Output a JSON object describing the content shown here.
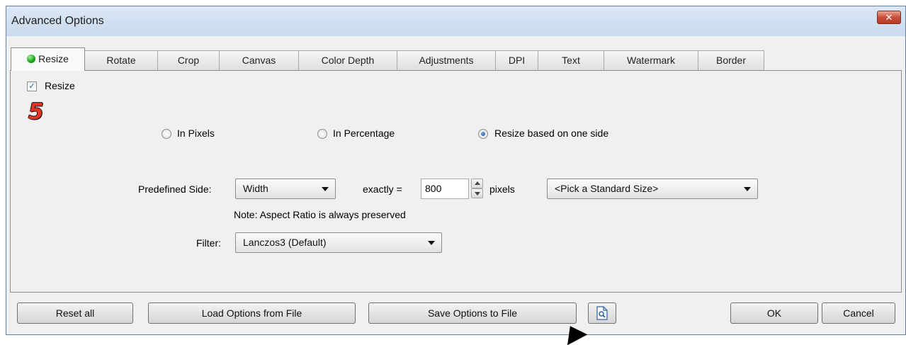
{
  "window": {
    "title": "Advanced Options",
    "close_glyph": "✕"
  },
  "tabs": [
    {
      "label": "Resize",
      "active": true,
      "icon": "green-dot-icon"
    },
    {
      "label": "Rotate"
    },
    {
      "label": "Crop"
    },
    {
      "label": "Canvas"
    },
    {
      "label": "Color Depth"
    },
    {
      "label": "Adjustments"
    },
    {
      "label": "DPI"
    },
    {
      "label": "Text"
    },
    {
      "label": "Watermark"
    },
    {
      "label": "Border"
    }
  ],
  "resize": {
    "enable_label": "Resize",
    "enable_checked": true,
    "annotation_number": "5",
    "modes": [
      {
        "label": "In Pixels",
        "selected": false
      },
      {
        "label": "In Percentage",
        "selected": false
      },
      {
        "label": "Resize based on one side",
        "selected": true
      }
    ],
    "predefined_side_label": "Predefined Side:",
    "predefined_side_value": "Width",
    "exactly_label": "exactly =",
    "exactly_value": "800",
    "unit_label": "pixels",
    "standard_size_value": "<Pick a Standard Size>",
    "note": "Note: Aspect Ratio is always preserved",
    "filter_label": "Filter:",
    "filter_value": "Lanczos3 (Default)"
  },
  "footer": {
    "reset_all": "Reset all",
    "load_options": "Load Options from File",
    "save_options": "Save Options to File",
    "ok": "OK",
    "cancel": "Cancel"
  },
  "colors": {
    "titlebar": "#c9daee",
    "client_bg": "#f0f0f0",
    "close_red": "#c9503b",
    "annotation_red": "#e53324"
  }
}
